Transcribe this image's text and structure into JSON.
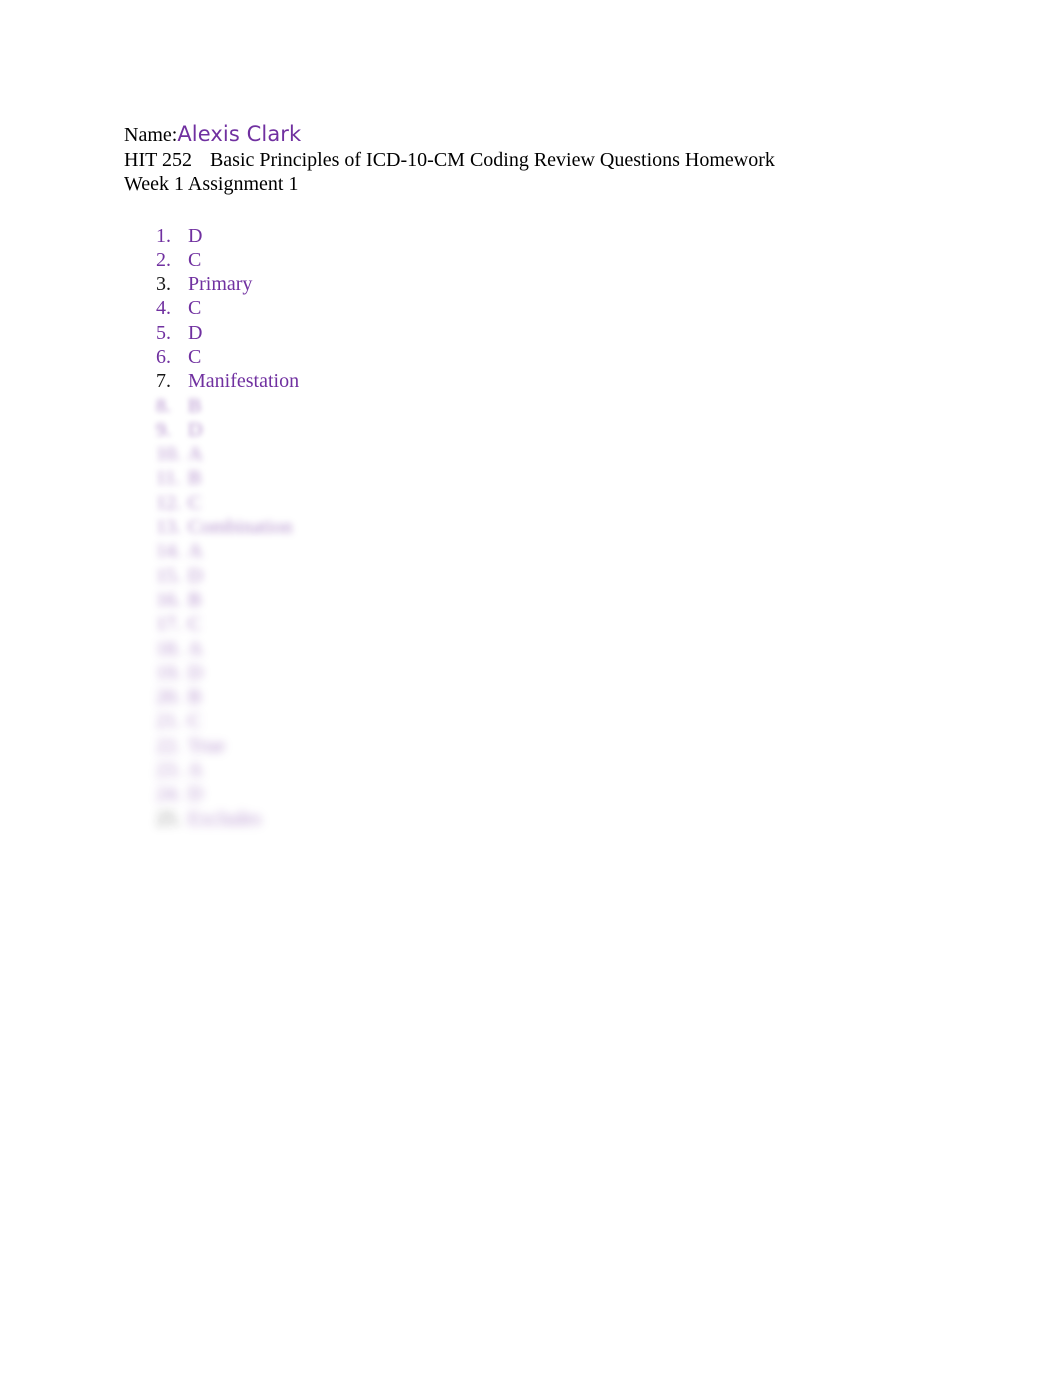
{
  "document": {
    "header": {
      "name_label": "Name:",
      "student_name": "Alexis Clark",
      "course_code": "HIT 252",
      "course_title": "Basic Principles of ICD-10-CM Coding Review Questions Homework",
      "assignment_line": "Week 1 Assignment 1"
    },
    "colors": {
      "accent_purple": "#7030a0",
      "body_black": "#000000",
      "page_background": "#ffffff"
    },
    "answers": {
      "visible": [
        {
          "number": "1.",
          "answer": "D",
          "number_color": "#7030a0"
        },
        {
          "number": "2.",
          "answer": "C",
          "number_color": "#7030a0"
        },
        {
          "number": "3.",
          "answer": "Primary",
          "number_color": "#161616"
        },
        {
          "number": "4.",
          "answer": "C",
          "number_color": "#7030a0"
        },
        {
          "number": "5.",
          "answer": "D",
          "number_color": "#7030a0"
        },
        {
          "number": "6.",
          "answer": "C",
          "number_color": "#7030a0"
        },
        {
          "number": "7.",
          "answer": "Manifestation",
          "number_color": "#161616"
        }
      ],
      "obscured": [
        {
          "number": "8.",
          "answer": "B"
        },
        {
          "number": "9.",
          "answer": "D"
        },
        {
          "number": "10.",
          "answer": "A"
        },
        {
          "number": "11.",
          "answer": "B"
        },
        {
          "number": "12.",
          "answer": "C"
        },
        {
          "number": "13.",
          "answer": "Combination"
        },
        {
          "number": "14.",
          "answer": "A"
        },
        {
          "number": "15.",
          "answer": "D"
        },
        {
          "number": "16.",
          "answer": "B"
        },
        {
          "number": "17.",
          "answer": "C"
        },
        {
          "number": "18.",
          "answer": "A"
        },
        {
          "number": "19.",
          "answer": "D"
        },
        {
          "number": "20.",
          "answer": "B"
        },
        {
          "number": "21.",
          "answer": "C"
        },
        {
          "number": "22.",
          "answer": "True"
        },
        {
          "number": "23.",
          "answer": "A"
        },
        {
          "number": "24.",
          "answer": "D"
        },
        {
          "number": "25.",
          "answer": "Excludes"
        }
      ]
    }
  }
}
